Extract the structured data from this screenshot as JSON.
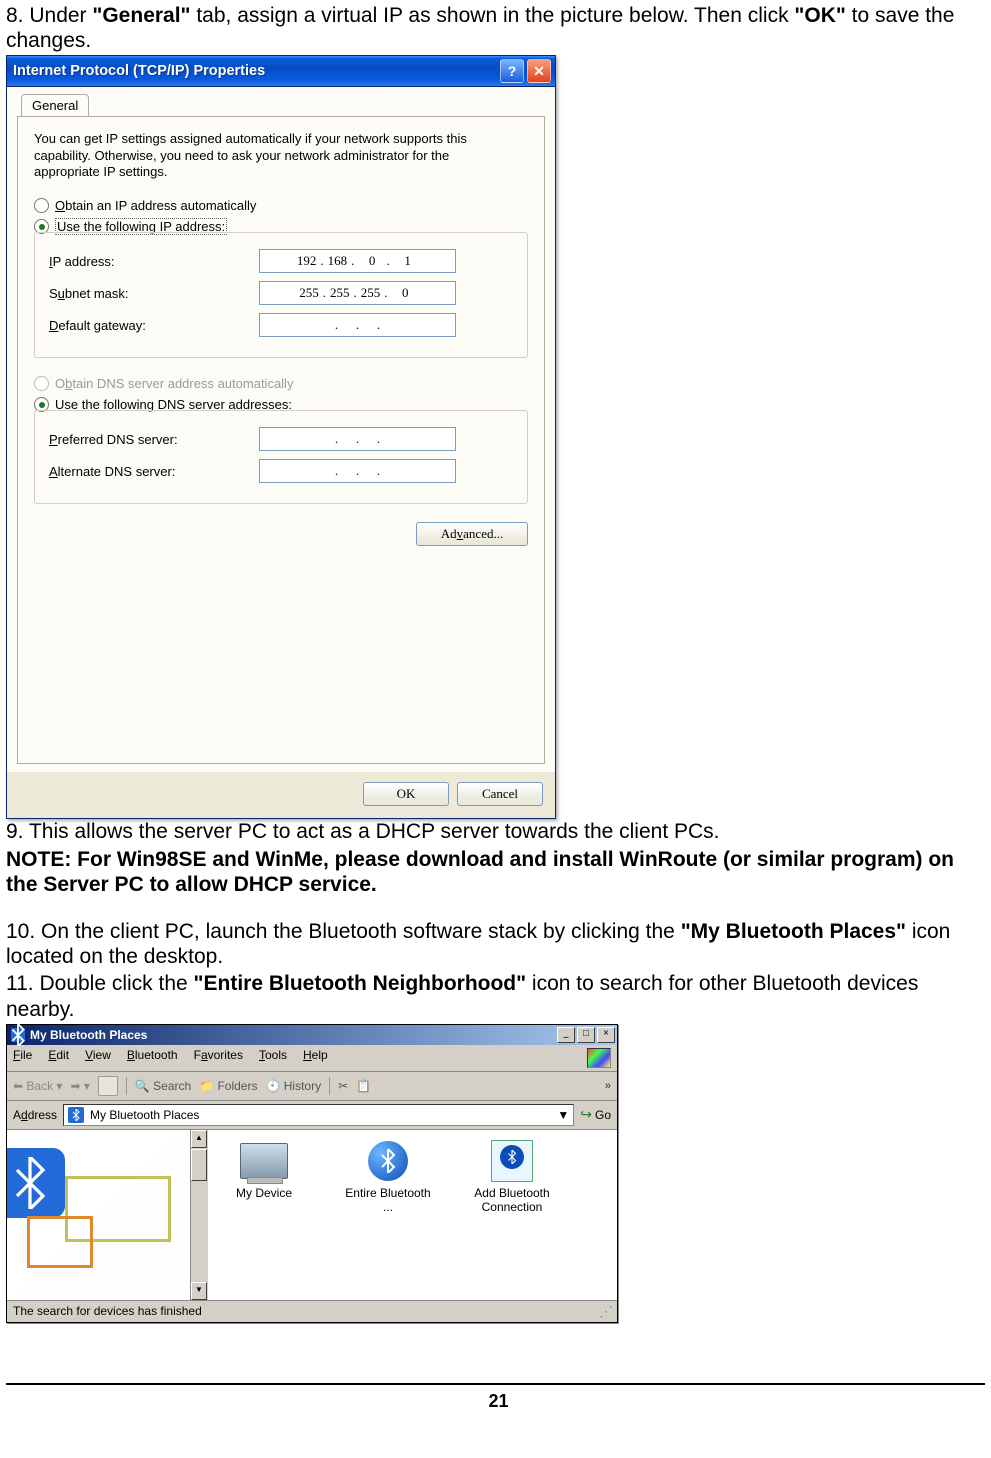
{
  "step8": {
    "prefix": "8. Under ",
    "bold1": "\"General\"",
    "mid": " tab, assign a virtual IP as shown in the picture below. Then click ",
    "bold2": "\"OK\"",
    "suffix": " to save the changes."
  },
  "dialog": {
    "title": "Internet Protocol (TCP/IP) Properties",
    "tab": "General",
    "description": "You can get IP settings assigned automatically if your network supports this capability. Otherwise, you need to ask your network administrator for the appropriate IP settings.",
    "radio_auto_ip": "Obtain an IP address automatically",
    "radio_use_ip": "Use the following IP address:",
    "label_ip": "IP address:",
    "value_ip": [
      "192",
      "168",
      "0",
      "1"
    ],
    "label_subnet": "Subnet mask:",
    "value_subnet": [
      "255",
      "255",
      "255",
      "0"
    ],
    "label_gateway": "Default gateway:",
    "radio_auto_dns": "Obtain DNS server address automatically",
    "radio_use_dns": "Use the following DNS server addresses:",
    "label_pref_dns": "Preferred DNS server:",
    "label_alt_dns": "Alternate DNS server:",
    "btn_advanced": "Advanced...",
    "btn_ok": "OK",
    "btn_cancel": "Cancel"
  },
  "step9": "9. This allows the server PC to act as a DHCP server towards the client PCs.",
  "note": "NOTE: For Win98SE and WinMe, please download and install WinRoute (or similar program) on the Server PC to allow DHCP service.",
  "step10": {
    "prefix": "10. On the client PC, launch the Bluetooth software stack by clicking the ",
    "bold": "\"My Bluetooth Places\"",
    "suffix": " icon located on the desktop."
  },
  "step11": {
    "prefix": "11. Double click the ",
    "bold": "\"Entire Bluetooth Neighborhood\"",
    "suffix": " icon to search for other Bluetooth devices nearby."
  },
  "bt": {
    "title": "My Bluetooth Places",
    "menu": [
      "File",
      "Edit",
      "View",
      "Bluetooth",
      "Favorites",
      "Tools",
      "Help"
    ],
    "back": "Back",
    "toolbar": [
      "Search",
      "Folders",
      "History"
    ],
    "more": "»",
    "address_label": "Address",
    "address_value": "My Bluetooth Places",
    "go": "Go",
    "items": [
      {
        "label": "My Device"
      },
      {
        "label": "Entire Bluetooth ..."
      },
      {
        "label": "Add Bluetooth Connection"
      }
    ],
    "status": "The search for devices has finished"
  },
  "page_number": "21"
}
